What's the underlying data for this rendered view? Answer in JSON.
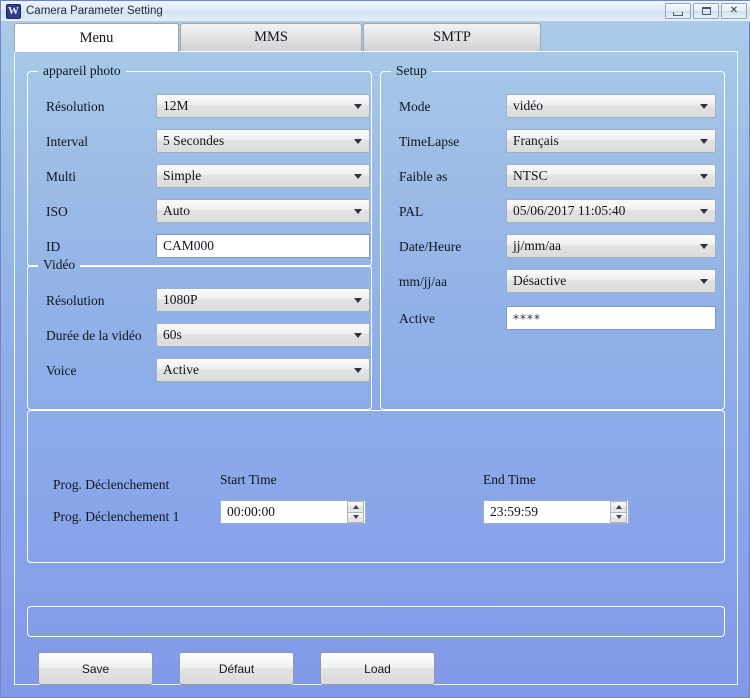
{
  "window": {
    "title": "Camera Parameter Setting",
    "app_icon": "camera-app-icon",
    "minimize_label": "minimize-icon",
    "maximize_label": "maximize-icon",
    "close_label": "✕"
  },
  "tabs": [
    {
      "label": "Menu",
      "active": true
    },
    {
      "label": "MMS",
      "active": false
    },
    {
      "label": "SMTP",
      "active": false
    }
  ],
  "groups": {
    "appareil": {
      "title": "appareil photo",
      "fields": [
        {
          "label": "Résolution",
          "value": "12M",
          "type": "combo"
        },
        {
          "label": "Interval",
          "value": "5 Secondes",
          "type": "combo"
        },
        {
          "label": "Multi",
          "value": "Simple",
          "type": "combo"
        },
        {
          "label": "ISO",
          "value": "Auto",
          "type": "combo"
        },
        {
          "label": "ID",
          "value": "CAM000",
          "type": "text"
        }
      ]
    },
    "video": {
      "title": "Vidéo",
      "fields": [
        {
          "label": "Résolution",
          "value": "1080P",
          "type": "combo"
        },
        {
          "label": "Durée de la vidéo",
          "value": "60s",
          "type": "combo"
        },
        {
          "label": "Voice",
          "value": "Active",
          "type": "combo"
        }
      ]
    },
    "setup": {
      "title": "Setup",
      "fields": [
        {
          "label": "Mode",
          "value": "vidéo",
          "type": "combo"
        },
        {
          "label": "TimeLapse",
          "value": "Français",
          "type": "combo"
        },
        {
          "label": "Faible ǝs",
          "value": "NTSC",
          "type": "combo"
        },
        {
          "label": "PAL",
          "value": "05/06/2017 11:05:40",
          "type": "combo"
        },
        {
          "label": "Date/Heure",
          "value": "jj/mm/aa",
          "type": "combo"
        },
        {
          "label": "mm/jj/aa",
          "value": "Désactive",
          "type": "combo"
        },
        {
          "label": "Active",
          "value": "****",
          "type": "password"
        }
      ]
    },
    "schedule": {
      "row_label": "Prog. Déclenchement",
      "entry_label": "Prog. Déclenchement 1",
      "start_header": "Start Time",
      "end_header": "End Time",
      "start_value": "00:00:00",
      "end_value": "23:59:59",
      "spin_up_icon": "spinner-up-icon",
      "spin_down_icon": "spinner-down-icon"
    }
  },
  "buttons": {
    "save": "Save",
    "default": "Défaut",
    "load": "Load"
  },
  "colors": {
    "window_bg_top": "#a9cbe9",
    "window_bg_bottom": "#8098e8",
    "titlebar": "#e4eef8",
    "active_tab": "#ffffff",
    "inactive_tab": "#e4e4e4",
    "group_border": "#ffffff",
    "text": "#10161d",
    "field_bg": "#ffffff",
    "combo_bg": "#eeeeee"
  }
}
